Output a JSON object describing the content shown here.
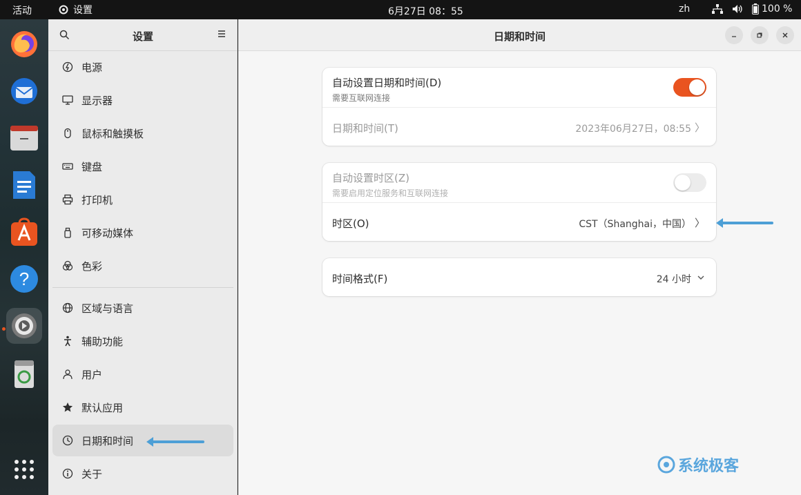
{
  "topbar": {
    "activities": "活动",
    "app_name": "设置",
    "clock": "6月27日  08：55",
    "lang": "zh",
    "battery": "100 %"
  },
  "dock": {
    "items": [
      "firefox-icon",
      "thunderbird-icon",
      "files-icon",
      "writer-icon",
      "app-center-icon",
      "help-icon",
      "settings-icon",
      "trash-icon",
      "show-apps-icon"
    ]
  },
  "sidebar": {
    "title": "设置",
    "items": [
      {
        "label": "电源",
        "icon": "power-icon"
      },
      {
        "label": "显示器",
        "icon": "display-icon"
      },
      {
        "label": "鼠标和触摸板",
        "icon": "mouse-icon"
      },
      {
        "label": "键盘",
        "icon": "keyboard-icon"
      },
      {
        "label": "打印机",
        "icon": "printer-icon"
      },
      {
        "label": "可移动媒体",
        "icon": "removable-media-icon"
      },
      {
        "label": "色彩",
        "icon": "color-icon"
      },
      {
        "label": "区域与语言",
        "icon": "globe-icon"
      },
      {
        "label": "辅助功能",
        "icon": "accessibility-icon"
      },
      {
        "label": "用户",
        "icon": "user-icon"
      },
      {
        "label": "默认应用",
        "icon": "star-icon"
      },
      {
        "label": "日期和时间",
        "icon": "clock-icon"
      },
      {
        "label": "关于",
        "icon": "info-icon"
      }
    ]
  },
  "main": {
    "title": "日期和时间",
    "auto_datetime": {
      "label": "自动设置日期和时间(D)",
      "sub": "需要互联网连接",
      "enabled": true
    },
    "datetime": {
      "label": "日期和时间(T)",
      "value": "2023年06月27日，08:55"
    },
    "auto_timezone": {
      "label": "自动设置时区(Z)",
      "sub": "需要启用定位服务和互联网连接",
      "enabled": false
    },
    "timezone": {
      "label": "时区(O)",
      "value": "CST（Shanghai，中国）"
    },
    "time_format": {
      "label": "时间格式(F)",
      "value": "24 小时"
    }
  },
  "watermark": "系统极客",
  "colors": {
    "accent": "#e95420",
    "arrow": "#4d9fd6"
  }
}
